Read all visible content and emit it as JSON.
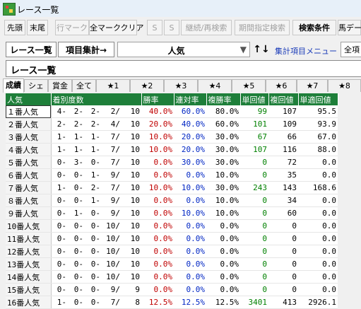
{
  "window": {
    "title": "レース一覧"
  },
  "toolbar1": [
    {
      "label": "先頭",
      "state": "normal"
    },
    {
      "label": "末尾",
      "state": "normal"
    },
    {
      "label": "行マーク",
      "state": "disabled"
    },
    {
      "label": "全マーククリア",
      "state": "normal"
    },
    {
      "label": "S",
      "state": "disabled"
    },
    {
      "label": "S",
      "state": "disabled"
    },
    {
      "label": "継続/再検索",
      "state": "disabled"
    },
    {
      "label": "期間指定検索",
      "state": "disabled"
    },
    {
      "label": "検索条件",
      "state": "bold"
    },
    {
      "label": "馬デー",
      "state": "normal"
    }
  ],
  "toolbar2": {
    "race_list": "レース一覧",
    "koumoku": "項目集計→",
    "combo_value": "人気",
    "updown": "↑↓",
    "menu_link": "集計項目メニュー",
    "zenkou": "全項"
  },
  "heading": "レース一覧",
  "tabs": [
    "成績",
    "シェア",
    "賞金",
    "全て",
    "★1",
    "★2",
    "★3",
    "★4",
    "★5",
    "★6",
    "★7",
    "★8"
  ],
  "table": {
    "headers": [
      "人気",
      "着別度数",
      "勝率",
      "連対率",
      "複勝率",
      "単回値",
      "複回値",
      "単適回値"
    ],
    "rows": [
      [
        "１番人気",
        "4-",
        "2-",
        "2-",
        "2/",
        "10",
        "40.0%",
        "60.0%",
        "80.0%",
        "99",
        "107",
        "95.5"
      ],
      [
        "２番人気",
        "2-",
        "2-",
        "2-",
        "4/",
        "10",
        "20.0%",
        "40.0%",
        "60.0%",
        "101",
        "109",
        "93.9"
      ],
      [
        "３番人気",
        "1-",
        "1-",
        "1-",
        "7/",
        "10",
        "10.0%",
        "20.0%",
        "30.0%",
        "67",
        "66",
        "67.0"
      ],
      [
        "４番人気",
        "1-",
        "1-",
        "1-",
        "7/",
        "10",
        "10.0%",
        "20.0%",
        "30.0%",
        "107",
        "116",
        "88.0"
      ],
      [
        "５番人気",
        "0-",
        "3-",
        "0-",
        "7/",
        "10",
        "0.0%",
        "30.0%",
        "30.0%",
        "0",
        "72",
        "0.0"
      ],
      [
        "６番人気",
        "0-",
        "0-",
        "1-",
        "9/",
        "10",
        "0.0%",
        "0.0%",
        "10.0%",
        "0",
        "35",
        "0.0"
      ],
      [
        "７番人気",
        "1-",
        "0-",
        "2-",
        "7/",
        "10",
        "10.0%",
        "10.0%",
        "30.0%",
        "243",
        "143",
        "168.6"
      ],
      [
        "８番人気",
        "0-",
        "0-",
        "1-",
        "9/",
        "10",
        "0.0%",
        "0.0%",
        "10.0%",
        "0",
        "34",
        "0.0"
      ],
      [
        "９番人気",
        "0-",
        "1-",
        "0-",
        "9/",
        "10",
        "0.0%",
        "10.0%",
        "10.0%",
        "0",
        "60",
        "0.0"
      ],
      [
        "10番人気",
        "0-",
        "0-",
        "0-",
        "10/",
        "10",
        "0.0%",
        "0.0%",
        "0.0%",
        "0",
        "0",
        "0.0"
      ],
      [
        "11番人気",
        "0-",
        "0-",
        "0-",
        "10/",
        "10",
        "0.0%",
        "0.0%",
        "0.0%",
        "0",
        "0",
        "0.0"
      ],
      [
        "12番人気",
        "0-",
        "0-",
        "0-",
        "10/",
        "10",
        "0.0%",
        "0.0%",
        "0.0%",
        "0",
        "0",
        "0.0"
      ],
      [
        "13番人気",
        "0-",
        "0-",
        "0-",
        "10/",
        "10",
        "0.0%",
        "0.0%",
        "0.0%",
        "0",
        "0",
        "0.0"
      ],
      [
        "14番人気",
        "0-",
        "0-",
        "0-",
        "10/",
        "10",
        "0.0%",
        "0.0%",
        "0.0%",
        "0",
        "0",
        "0.0"
      ],
      [
        "15番人気",
        "0-",
        "0-",
        "0-",
        "9/",
        "9",
        "0.0%",
        "0.0%",
        "0.0%",
        "0",
        "0",
        "0.0"
      ],
      [
        "16番人気",
        "1-",
        "0-",
        "0-",
        "7/",
        "8",
        "12.5%",
        "12.5%",
        "12.5%",
        "3401",
        "413",
        "2926.1"
      ]
    ]
  },
  "colors": {
    "header_bg": "#1e7f3a",
    "win": "#c00000",
    "place": "#0026c4",
    "tan": "#008000"
  }
}
